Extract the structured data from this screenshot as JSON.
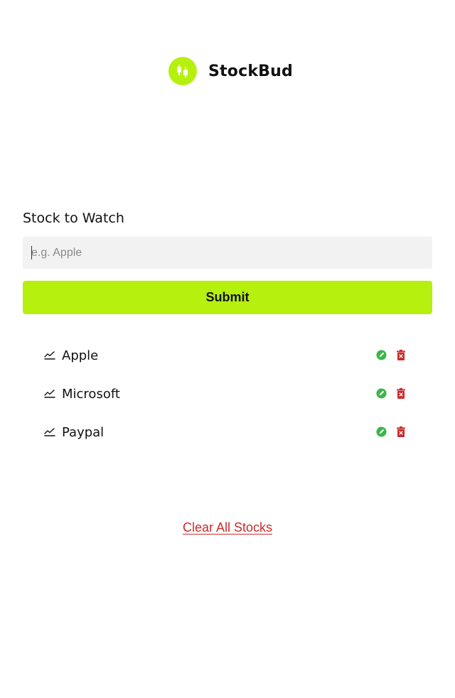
{
  "app": {
    "name": "StockBud",
    "logo_icon": "candlestick-chart-icon",
    "accent_color": "#b5f00f"
  },
  "form": {
    "label": "Stock to Watch",
    "input_placeholder": "e.g. Apple",
    "input_value": "",
    "submit_label": "Submit"
  },
  "stocks": [
    {
      "name": "Apple",
      "icon": "trend-line-icon"
    },
    {
      "name": "Microsoft",
      "icon": "trend-line-icon"
    },
    {
      "name": "Paypal",
      "icon": "trend-line-icon"
    }
  ],
  "row_actions": {
    "edit_icon": "edit-icon",
    "edit_color": "#3bb54a",
    "delete_icon": "trash-icon",
    "delete_color": "#cc2a2a"
  },
  "clear_all_label": "Clear All Stocks"
}
